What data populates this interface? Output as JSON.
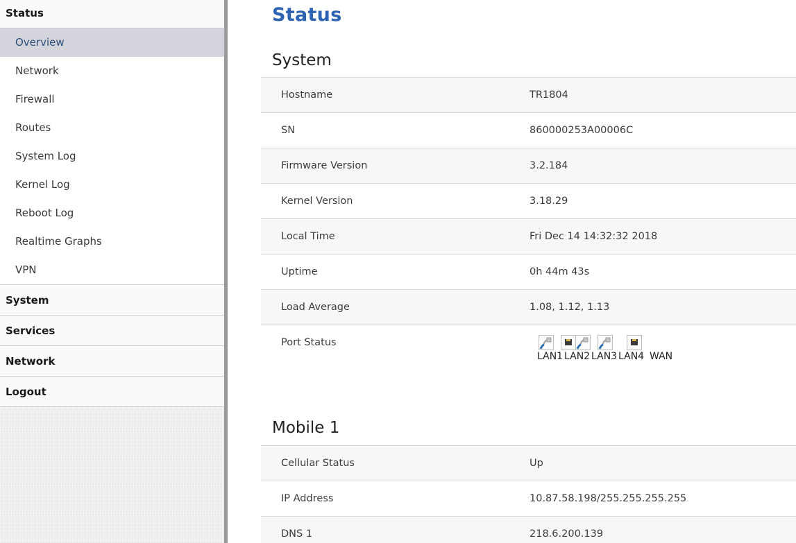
{
  "sidebar": {
    "categories": [
      {
        "label": "Status"
      },
      {
        "label": "System"
      },
      {
        "label": "Services"
      },
      {
        "label": "Network"
      },
      {
        "label": "Logout"
      }
    ],
    "status_items": [
      {
        "label": "Overview"
      },
      {
        "label": "Network"
      },
      {
        "label": "Firewall"
      },
      {
        "label": "Routes"
      },
      {
        "label": "System Log"
      },
      {
        "label": "Kernel Log"
      },
      {
        "label": "Reboot Log"
      },
      {
        "label": "Realtime Graphs"
      },
      {
        "label": "VPN"
      }
    ],
    "active_item": "Overview"
  },
  "main": {
    "title": "Status",
    "system": {
      "title": "System",
      "rows": [
        {
          "key": "Hostname",
          "value": "TR1804"
        },
        {
          "key": "SN",
          "value": "860000253A00006C"
        },
        {
          "key": "Firmware Version",
          "value": "3.2.184"
        },
        {
          "key": "Kernel Version",
          "value": "3.18.29"
        },
        {
          "key": "Local Time",
          "value": "Fri Dec 14 14:32:32 2018"
        },
        {
          "key": "Uptime",
          "value": "0h 44m 43s"
        },
        {
          "key": "Load Average",
          "value": "1.08, 1.12, 1.13"
        }
      ],
      "port_status": {
        "key": "Port Status",
        "ports": [
          {
            "label": "LAN1",
            "state": "connected",
            "icon": "ethernet-cable-connected-icon"
          },
          {
            "label": "LAN2",
            "state": "disconnected",
            "icon": "ethernet-port-empty-icon"
          },
          {
            "label": "LAN3",
            "state": "connected",
            "icon": "ethernet-cable-connected-icon"
          },
          {
            "label": "LAN4",
            "state": "connected",
            "icon": "ethernet-cable-connected-icon"
          },
          {
            "label": "WAN",
            "state": "disconnected",
            "icon": "ethernet-port-empty-icon"
          }
        ]
      }
    },
    "mobile": {
      "title": "Mobile 1",
      "rows": [
        {
          "key": "Cellular Status",
          "value": "Up"
        },
        {
          "key": "IP Address",
          "value": "10.87.58.198/255.255.255.255"
        },
        {
          "key": "DNS 1",
          "value": "218.6.200.139"
        }
      ]
    }
  },
  "colors": {
    "title_blue": "#2c63b2",
    "active_item_bg": "#d4d4dd",
    "port_connected_blue": "#2f6fb5"
  }
}
